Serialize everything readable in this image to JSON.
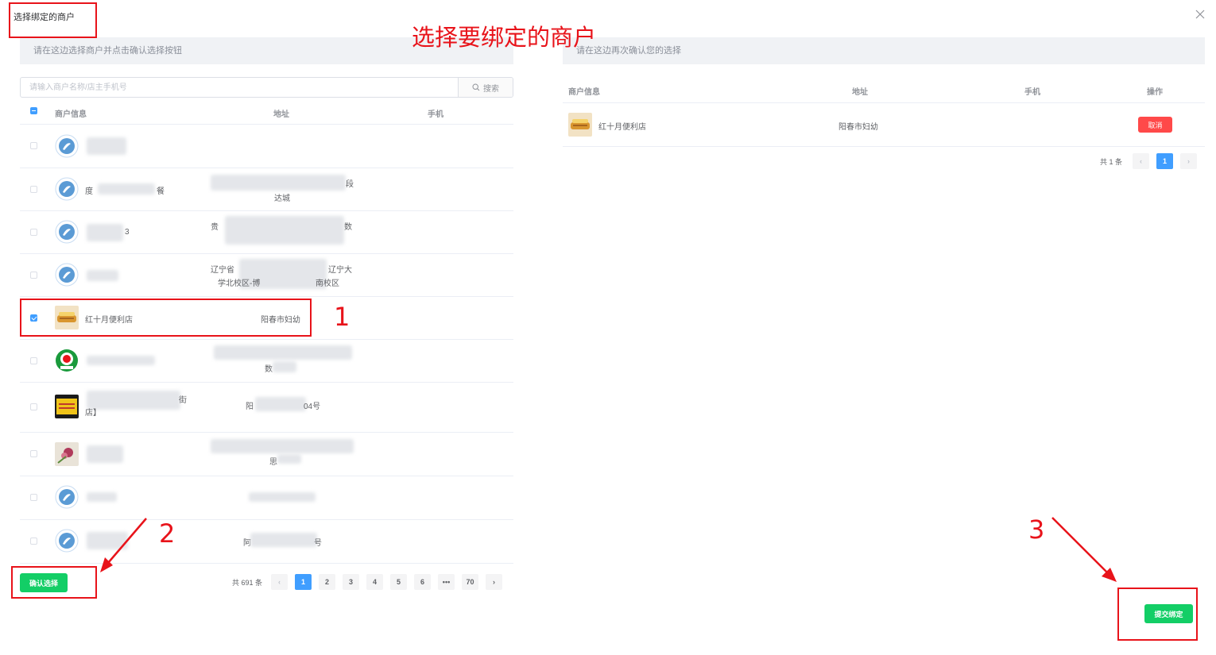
{
  "dialog": {
    "title": "选择绑定的商户",
    "close": "×"
  },
  "left": {
    "tip": "请在这边选择商户并点击确认选择按钮",
    "search": {
      "placeholder": "请输入商户名称/店主手机号",
      "button": "搜索"
    },
    "columns": {
      "info": "商户信息",
      "address": "地址",
      "phone": "手机"
    },
    "rows": [
      {
        "name": "",
        "address": "",
        "checked": false,
        "avatar": "logo"
      },
      {
        "name": "度",
        "name_tail": "餐",
        "address": "",
        "address2": "达城",
        "address_tail": "段",
        "checked": false,
        "avatar": "logo"
      },
      {
        "name": "",
        "name_tail": "3",
        "address": "贵",
        "address_tail": "数",
        "checked": false,
        "avatar": "logo"
      },
      {
        "name": "",
        "address": "辽宁省",
        "address_tail": "辽宁大",
        "address2": "学北校区-博",
        "address2_tail": "南校区",
        "checked": false,
        "avatar": "logo"
      },
      {
        "name": "红十月便利店",
        "address": "阳春市妇幼",
        "checked": true,
        "avatar": "food"
      },
      {
        "name": "",
        "address": "",
        "address2": "数",
        "checked": false,
        "avatar": "green"
      },
      {
        "name": "",
        "name_tail": "街",
        "name2": "店】",
        "address": "阳",
        "address_tail": "04号",
        "checked": false,
        "avatar": "sign"
      },
      {
        "name": "",
        "address": "",
        "address2": "思",
        "checked": false,
        "avatar": "flower"
      },
      {
        "name": "",
        "address": "",
        "checked": false,
        "avatar": "logo"
      },
      {
        "name": "",
        "address": "阿",
        "address_tail": "号",
        "checked": false,
        "avatar": "logo"
      }
    ],
    "pager": {
      "total": "共 691 条",
      "pages": [
        "1",
        "2",
        "3",
        "4",
        "5",
        "6",
        "•••",
        "70"
      ],
      "current": "1"
    },
    "confirm_button": "确认选择"
  },
  "right": {
    "tip": "请在这边再次确认您的选择",
    "columns": {
      "info": "商户信息",
      "address": "地址",
      "phone": "手机",
      "action": "操作"
    },
    "rows": [
      {
        "name": "红十月便利店",
        "address": "阳春市妇幼",
        "phone": "",
        "action": "取消"
      }
    ],
    "pager": {
      "total": "共 1 条",
      "current": "1"
    },
    "submit_button": "提交绑定"
  },
  "annotations": {
    "heading": "选择要绑定的商户",
    "step1": "1",
    "step2": "2",
    "step3": "3",
    "color": "#e8131a"
  }
}
